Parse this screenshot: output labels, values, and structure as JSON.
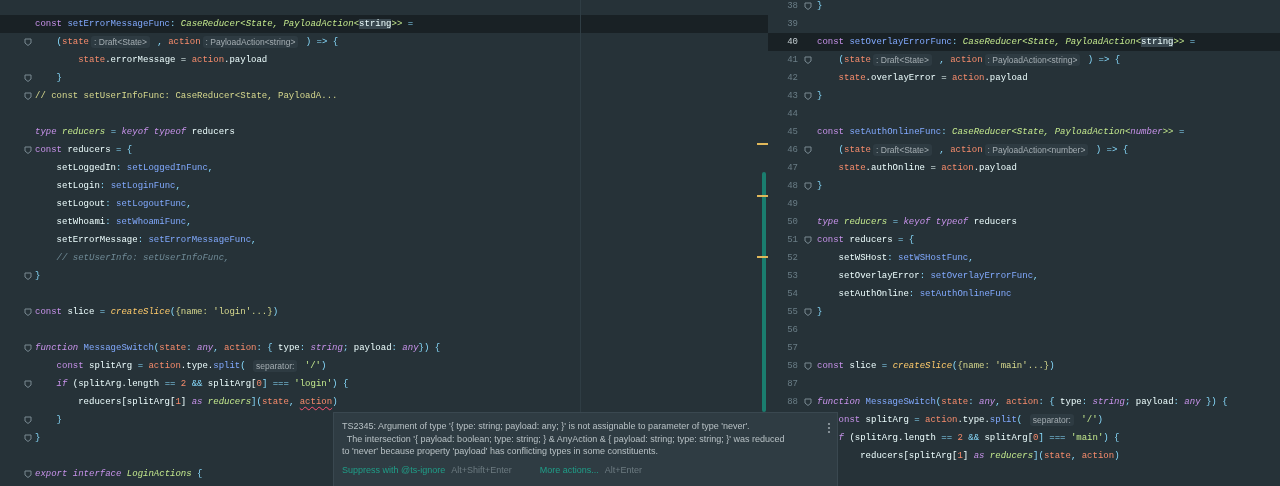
{
  "left_pane": {
    "lines": [
      {
        "current": true,
        "fold": false,
        "tokens": [
          {
            "text": "const ",
            "kind": "kw"
          },
          {
            "text": "setErrorMessageFunc",
            "kind": "fn"
          },
          {
            "text": ": ",
            "kind": "punct"
          },
          {
            "text": "CaseReducer<State, PayloadAction<",
            "kind": "type"
          },
          {
            "text": "string",
            "kind": "match"
          },
          {
            "text": ">>",
            "kind": "type"
          },
          {
            "text": " =",
            "kind": "punct"
          }
        ]
      },
      {
        "current": false,
        "fold": true,
        "tokens": [
          {
            "text": "    (",
            "kind": "punct"
          },
          {
            "text": "state",
            "kind": "param"
          },
          {
            "text": ": Draft<State>",
            "kind": "hint"
          },
          {
            "text": " , ",
            "kind": "punct"
          },
          {
            "text": "action",
            "kind": "param"
          },
          {
            "text": ": PayloadAction<string>",
            "kind": "hint"
          },
          {
            "text": " ) => {",
            "kind": "punct"
          }
        ]
      },
      {
        "current": false,
        "fold": false,
        "tokens": [
          {
            "text": "        state",
            "kind": "param"
          },
          {
            "text": ".errorMessage = ",
            "kind": "plain"
          },
          {
            "text": "action",
            "kind": "param"
          },
          {
            "text": ".payload",
            "kind": "plain"
          }
        ]
      },
      {
        "current": false,
        "fold": true,
        "tokens": [
          {
            "text": "    }",
            "kind": "punct"
          }
        ]
      },
      {
        "current": false,
        "fold": true,
        "tokens": [
          {
            "text": "// const setUserInfoFunc: CaseReducer<State, PayloadA...",
            "kind": "folded"
          }
        ]
      },
      {
        "current": false,
        "fold": false
      },
      {
        "current": false,
        "fold": false,
        "tokens": [
          {
            "text": "type ",
            "kind": "kwi"
          },
          {
            "text": "reducers",
            "kind": "type"
          },
          {
            "text": " = ",
            "kind": "punct"
          },
          {
            "text": "keyof typeof ",
            "kind": "kwi"
          },
          {
            "text": "reducers",
            "kind": "plain"
          }
        ]
      },
      {
        "current": false,
        "fold": true,
        "tokens": [
          {
            "text": "const ",
            "kind": "kw"
          },
          {
            "text": "reducers",
            "kind": "plain"
          },
          {
            "text": " = {",
            "kind": "punct"
          }
        ]
      },
      {
        "current": false,
        "fold": false,
        "tokens": [
          {
            "text": "    setLoggedIn",
            "kind": "plain"
          },
          {
            "text": ": ",
            "kind": "punct"
          },
          {
            "text": "setLoggedInFunc",
            "kind": "fn"
          },
          {
            "text": ",",
            "kind": "punct"
          }
        ]
      },
      {
        "current": false,
        "fold": false,
        "tokens": [
          {
            "text": "    setLogin",
            "kind": "plain"
          },
          {
            "text": ": ",
            "kind": "punct"
          },
          {
            "text": "setLoginFunc",
            "kind": "fn"
          },
          {
            "text": ",",
            "kind": "punct"
          }
        ]
      },
      {
        "current": false,
        "fold": false,
        "tokens": [
          {
            "text": "    setLogout",
            "kind": "plain"
          },
          {
            "text": ": ",
            "kind": "punct"
          },
          {
            "text": "setLogoutFunc",
            "kind": "fn"
          },
          {
            "text": ",",
            "kind": "punct"
          }
        ]
      },
      {
        "current": false,
        "fold": false,
        "tokens": [
          {
            "text": "    setWhoami",
            "kind": "plain"
          },
          {
            "text": ": ",
            "kind": "punct"
          },
          {
            "text": "setWhoamiFunc",
            "kind": "fn"
          },
          {
            "text": ",",
            "kind": "punct"
          }
        ]
      },
      {
        "current": false,
        "fold": false,
        "tokens": [
          {
            "text": "    setErrorMessage",
            "kind": "plain"
          },
          {
            "text": ": ",
            "kind": "punct"
          },
          {
            "text": "setErrorMessageFunc",
            "kind": "fn"
          },
          {
            "text": ",",
            "kind": "punct"
          }
        ]
      },
      {
        "current": false,
        "fold": false,
        "tokens": [
          {
            "text": "    // setUserInfo: setUserInfoFunc,",
            "kind": "comment"
          }
        ]
      },
      {
        "current": false,
        "fold": true,
        "tokens": [
          {
            "text": "}",
            "kind": "punct"
          }
        ]
      },
      {
        "current": false,
        "fold": false
      },
      {
        "current": false,
        "fold": true,
        "tokens": [
          {
            "text": "const ",
            "kind": "kw"
          },
          {
            "text": "slice ",
            "kind": "plain"
          },
          {
            "text": "= ",
            "kind": "punct"
          },
          {
            "text": "createSlice",
            "kind": "call"
          },
          {
            "text": "(",
            "kind": "punct"
          },
          {
            "text": "{name: 'login'...}",
            "kind": "folded"
          },
          {
            "text": ")",
            "kind": "punct"
          }
        ]
      },
      {
        "current": false,
        "fold": false
      },
      {
        "current": false,
        "fold": true,
        "tokens": [
          {
            "text": "function ",
            "kind": "kwi"
          },
          {
            "text": "MessageSwitch",
            "kind": "fn"
          },
          {
            "text": "(",
            "kind": "punct"
          },
          {
            "text": "state",
            "kind": "param"
          },
          {
            "text": ": ",
            "kind": "punct"
          },
          {
            "text": "any",
            "kind": "kwi"
          },
          {
            "text": ", ",
            "kind": "punct"
          },
          {
            "text": "action",
            "kind": "param"
          },
          {
            "text": ": { ",
            "kind": "punct"
          },
          {
            "text": "type",
            "kind": "plain"
          },
          {
            "text": ": ",
            "kind": "punct"
          },
          {
            "text": "string",
            "kind": "kwi"
          },
          {
            "text": "; ",
            "kind": "punct"
          },
          {
            "text": "payload",
            "kind": "plain"
          },
          {
            "text": ": ",
            "kind": "punct"
          },
          {
            "text": "any",
            "kind": "kwi"
          },
          {
            "text": "}) {",
            "kind": "punct"
          }
        ]
      },
      {
        "current": false,
        "fold": false,
        "tokens": [
          {
            "text": "    const ",
            "kind": "kw"
          },
          {
            "text": "splitArg ",
            "kind": "plain"
          },
          {
            "text": "= ",
            "kind": "punct"
          },
          {
            "text": "action",
            "kind": "param"
          },
          {
            "text": ".type.",
            "kind": "plain"
          },
          {
            "text": "split",
            "kind": "fn"
          },
          {
            "text": "( ",
            "kind": "punct"
          },
          {
            "text": "separator:",
            "kind": "hint"
          },
          {
            "text": " '/'",
            "kind": "str"
          },
          {
            "text": ")",
            "kind": "punct"
          }
        ]
      },
      {
        "current": false,
        "fold": true,
        "tokens": [
          {
            "text": "    if ",
            "kind": "kwi"
          },
          {
            "text": "(splitArg.length ",
            "kind": "plain"
          },
          {
            "text": "== ",
            "kind": "punct"
          },
          {
            "text": "2 ",
            "kind": "num"
          },
          {
            "text": "&& ",
            "kind": "punct"
          },
          {
            "text": "splitArg[",
            "kind": "plain"
          },
          {
            "text": "0",
            "kind": "num"
          },
          {
            "text": "] === ",
            "kind": "punct"
          },
          {
            "text": "'login'",
            "kind": "str"
          },
          {
            "text": ") {",
            "kind": "punct"
          }
        ]
      },
      {
        "current": false,
        "fold": false,
        "tokens": [
          {
            "text": "        reducers[splitArg[",
            "kind": "plain"
          },
          {
            "text": "1",
            "kind": "num"
          },
          {
            "text": "] ",
            "kind": "plain"
          },
          {
            "text": "as ",
            "kind": "kwi"
          },
          {
            "text": "reducers",
            "kind": "type"
          },
          {
            "text": "](",
            "kind": "punct"
          },
          {
            "text": "state",
            "kind": "param"
          },
          {
            "text": ", ",
            "kind": "punct"
          },
          {
            "text": "action",
            "kind": "error"
          },
          {
            "text": ")",
            "kind": "punct"
          }
        ]
      },
      {
        "current": false,
        "fold": true,
        "tokens": [
          {
            "text": "    }",
            "kind": "punct"
          }
        ]
      },
      {
        "current": false,
        "fold": true,
        "tokens": [
          {
            "text": "}",
            "kind": "punct"
          }
        ]
      },
      {
        "current": false,
        "fold": false
      },
      {
        "current": false,
        "fold": true,
        "tokens": [
          {
            "text": "export ",
            "kind": "kwi"
          },
          {
            "text": "interface ",
            "kind": "kwi"
          },
          {
            "text": "LoginActions ",
            "kind": "type"
          },
          {
            "text": "{",
            "kind": "punct"
          }
        ]
      }
    ]
  },
  "right_pane": {
    "lines": [
      {
        "number": "38",
        "current": false,
        "fold": true,
        "tokens": [
          {
            "text": "}",
            "kind": "punct"
          }
        ]
      },
      {
        "number": "39",
        "current": false,
        "fold": false
      },
      {
        "number": "40",
        "current": true,
        "fold": false,
        "tokens": [
          {
            "text": "const ",
            "kind": "kw"
          },
          {
            "text": "setOverlayErrorFunc",
            "kind": "fn"
          },
          {
            "text": ": ",
            "kind": "punct"
          },
          {
            "text": "CaseReducer<State, PayloadAction<",
            "kind": "type"
          },
          {
            "text": "string",
            "kind": "match"
          },
          {
            "text": ">>",
            "kind": "type"
          },
          {
            "text": " =",
            "kind": "punct"
          }
        ]
      },
      {
        "number": "41",
        "current": false,
        "fold": true,
        "tokens": [
          {
            "text": "    (",
            "kind": "punct"
          },
          {
            "text": "state",
            "kind": "param"
          },
          {
            "text": ": Draft<State>",
            "kind": "hint"
          },
          {
            "text": " , ",
            "kind": "punct"
          },
          {
            "text": "action",
            "kind": "param"
          },
          {
            "text": ": PayloadAction<string>",
            "kind": "hint"
          },
          {
            "text": " ) => {",
            "kind": "punct"
          }
        ]
      },
      {
        "number": "42",
        "current": false,
        "fold": false,
        "tokens": [
          {
            "text": "    state",
            "kind": "param"
          },
          {
            "text": ".overlayError = ",
            "kind": "plain"
          },
          {
            "text": "action",
            "kind": "param"
          },
          {
            "text": ".payload",
            "kind": "plain"
          }
        ]
      },
      {
        "number": "43",
        "current": false,
        "fold": true,
        "tokens": [
          {
            "text": "}",
            "kind": "punct"
          }
        ]
      },
      {
        "number": "44",
        "current": false,
        "fold": false
      },
      {
        "number": "45",
        "current": false,
        "fold": false,
        "tokens": [
          {
            "text": "const ",
            "kind": "kw"
          },
          {
            "text": "setAuthOnlineFunc",
            "kind": "fn"
          },
          {
            "text": ": ",
            "kind": "punct"
          },
          {
            "text": "CaseReducer<State, PayloadAction<",
            "kind": "type"
          },
          {
            "text": "number",
            "kind": "kwi"
          },
          {
            "text": ">>",
            "kind": "type"
          },
          {
            "text": " =",
            "kind": "punct"
          }
        ]
      },
      {
        "number": "46",
        "current": false,
        "fold": true,
        "tokens": [
          {
            "text": "    (",
            "kind": "punct"
          },
          {
            "text": "state",
            "kind": "param"
          },
          {
            "text": ": Draft<State>",
            "kind": "hint"
          },
          {
            "text": " , ",
            "kind": "punct"
          },
          {
            "text": "action",
            "kind": "param"
          },
          {
            "text": ": PayloadAction<number>",
            "kind": "hint"
          },
          {
            "text": " ) => {",
            "kind": "punct"
          }
        ]
      },
      {
        "number": "47",
        "current": false,
        "fold": false,
        "tokens": [
          {
            "text": "    state",
            "kind": "param"
          },
          {
            "text": ".authOnline = ",
            "kind": "plain"
          },
          {
            "text": "action",
            "kind": "param"
          },
          {
            "text": ".payload",
            "kind": "plain"
          }
        ]
      },
      {
        "number": "48",
        "current": false,
        "fold": true,
        "tokens": [
          {
            "text": "}",
            "kind": "punct"
          }
        ]
      },
      {
        "number": "49",
        "current": false,
        "fold": false
      },
      {
        "number": "50",
        "current": false,
        "fold": false,
        "tokens": [
          {
            "text": "type ",
            "kind": "kwi"
          },
          {
            "text": "reducers",
            "kind": "type"
          },
          {
            "text": " = ",
            "kind": "punct"
          },
          {
            "text": "keyof typeof ",
            "kind": "kwi"
          },
          {
            "text": "reducers",
            "kind": "plain"
          }
        ]
      },
      {
        "number": "51",
        "current": false,
        "fold": true,
        "tokens": [
          {
            "text": "const ",
            "kind": "kw"
          },
          {
            "text": "reducers",
            "kind": "plain"
          },
          {
            "text": " = {",
            "kind": "punct"
          }
        ]
      },
      {
        "number": "52",
        "current": false,
        "fold": false,
        "tokens": [
          {
            "text": "    setWSHost",
            "kind": "plain"
          },
          {
            "text": ": ",
            "kind": "punct"
          },
          {
            "text": "setWSHostFunc",
            "kind": "fn"
          },
          {
            "text": ",",
            "kind": "punct"
          }
        ]
      },
      {
        "number": "53",
        "current": false,
        "fold": false,
        "tokens": [
          {
            "text": "    setOverlayError",
            "kind": "plain"
          },
          {
            "text": ": ",
            "kind": "punct"
          },
          {
            "text": "setOverlayErrorFunc",
            "kind": "fn"
          },
          {
            "text": ",",
            "kind": "punct"
          }
        ]
      },
      {
        "number": "54",
        "current": false,
        "fold": false,
        "tokens": [
          {
            "text": "    setAuthOnline",
            "kind": "plain"
          },
          {
            "text": ": ",
            "kind": "punct"
          },
          {
            "text": "setAuthOnlineFunc",
            "kind": "fn"
          }
        ]
      },
      {
        "number": "55",
        "current": false,
        "fold": true,
        "tokens": [
          {
            "text": "}",
            "kind": "punct"
          }
        ]
      },
      {
        "number": "56",
        "current": false,
        "fold": false
      },
      {
        "number": "57",
        "current": false,
        "fold": false
      },
      {
        "number": "58",
        "current": false,
        "fold": true,
        "tokens": [
          {
            "text": "const ",
            "kind": "kw"
          },
          {
            "text": "slice ",
            "kind": "plain"
          },
          {
            "text": "= ",
            "kind": "punct"
          },
          {
            "text": "createSlice",
            "kind": "call"
          },
          {
            "text": "(",
            "kind": "punct"
          },
          {
            "text": "{name: 'main'...}",
            "kind": "folded"
          },
          {
            "text": ")",
            "kind": "punct"
          }
        ]
      },
      {
        "number": "87",
        "current": false,
        "fold": false
      },
      {
        "number": "88",
        "current": false,
        "fold": true,
        "tokens": [
          {
            "text": "function ",
            "kind": "kwi"
          },
          {
            "text": "MessageSwitch",
            "kind": "fn"
          },
          {
            "text": "(",
            "kind": "punct"
          },
          {
            "text": "state",
            "kind": "param"
          },
          {
            "text": ": ",
            "kind": "punct"
          },
          {
            "text": "any",
            "kind": "kwi"
          },
          {
            "text": ", ",
            "kind": "punct"
          },
          {
            "text": "action",
            "kind": "param"
          },
          {
            "text": ": { ",
            "kind": "punct"
          },
          {
            "text": "type",
            "kind": "plain"
          },
          {
            "text": ": ",
            "kind": "punct"
          },
          {
            "text": "string",
            "kind": "kwi"
          },
          {
            "text": "; ",
            "kind": "punct"
          },
          {
            "text": "payload",
            "kind": "plain"
          },
          {
            "text": ": ",
            "kind": "punct"
          },
          {
            "text": "any",
            "kind": "kwi"
          },
          {
            "text": " }) {",
            "kind": "punct"
          }
        ]
      },
      {
        "current": false,
        "fold": false,
        "tokens": [
          {
            "text": "    onst ",
            "kind": "kw"
          },
          {
            "text": "splitArg ",
            "kind": "plain"
          },
          {
            "text": "= ",
            "kind": "punct"
          },
          {
            "text": "action",
            "kind": "param"
          },
          {
            "text": ".type.",
            "kind": "plain"
          },
          {
            "text": "split",
            "kind": "fn"
          },
          {
            "text": "( ",
            "kind": "punct"
          },
          {
            "text": "separator:",
            "kind": "hint"
          },
          {
            "text": " '/'",
            "kind": "str"
          },
          {
            "text": ")",
            "kind": "punct"
          }
        ]
      },
      {
        "current": false,
        "fold": false,
        "tokens": [
          {
            "text": "    f ",
            "kind": "kwi"
          },
          {
            "text": "(splitArg.length ",
            "kind": "plain"
          },
          {
            "text": "== ",
            "kind": "punct"
          },
          {
            "text": "2 ",
            "kind": "num"
          },
          {
            "text": "&& ",
            "kind": "punct"
          },
          {
            "text": "splitArg[",
            "kind": "plain"
          },
          {
            "text": "0",
            "kind": "num"
          },
          {
            "text": "] === ",
            "kind": "punct"
          },
          {
            "text": "'main'",
            "kind": "str"
          },
          {
            "text": ") {",
            "kind": "punct"
          }
        ]
      },
      {
        "current": false,
        "fold": false,
        "tokens": [
          {
            "text": "        reducers[splitArg[",
            "kind": "plain"
          },
          {
            "text": "1",
            "kind": "num"
          },
          {
            "text": "] ",
            "kind": "plain"
          },
          {
            "text": "as ",
            "kind": "kwi"
          },
          {
            "text": "reducers",
            "kind": "type"
          },
          {
            "text": "](",
            "kind": "punct"
          },
          {
            "text": "state",
            "kind": "param"
          },
          {
            "text": ", ",
            "kind": "punct"
          },
          {
            "text": "action",
            "kind": "param"
          },
          {
            "text": ")",
            "kind": "punct"
          }
        ]
      }
    ]
  },
  "error_popup": {
    "message_lines": [
      "TS2345: Argument of type '{ type: string; payload: any; }' is not assignable to parameter of type 'never'.",
      "  The intersection '{ payload: boolean; type: string; } & AnyAction & { payload: string; type: string; }' was reduced",
      "to 'never' because property 'payload' has conflicting types in some constituents."
    ],
    "actions": [
      {
        "label": "Suppress with @ts-ignore",
        "shortcut": "Alt+Shift+Enter"
      },
      {
        "label": "More actions...",
        "shortcut": "Alt+Enter"
      }
    ]
  }
}
